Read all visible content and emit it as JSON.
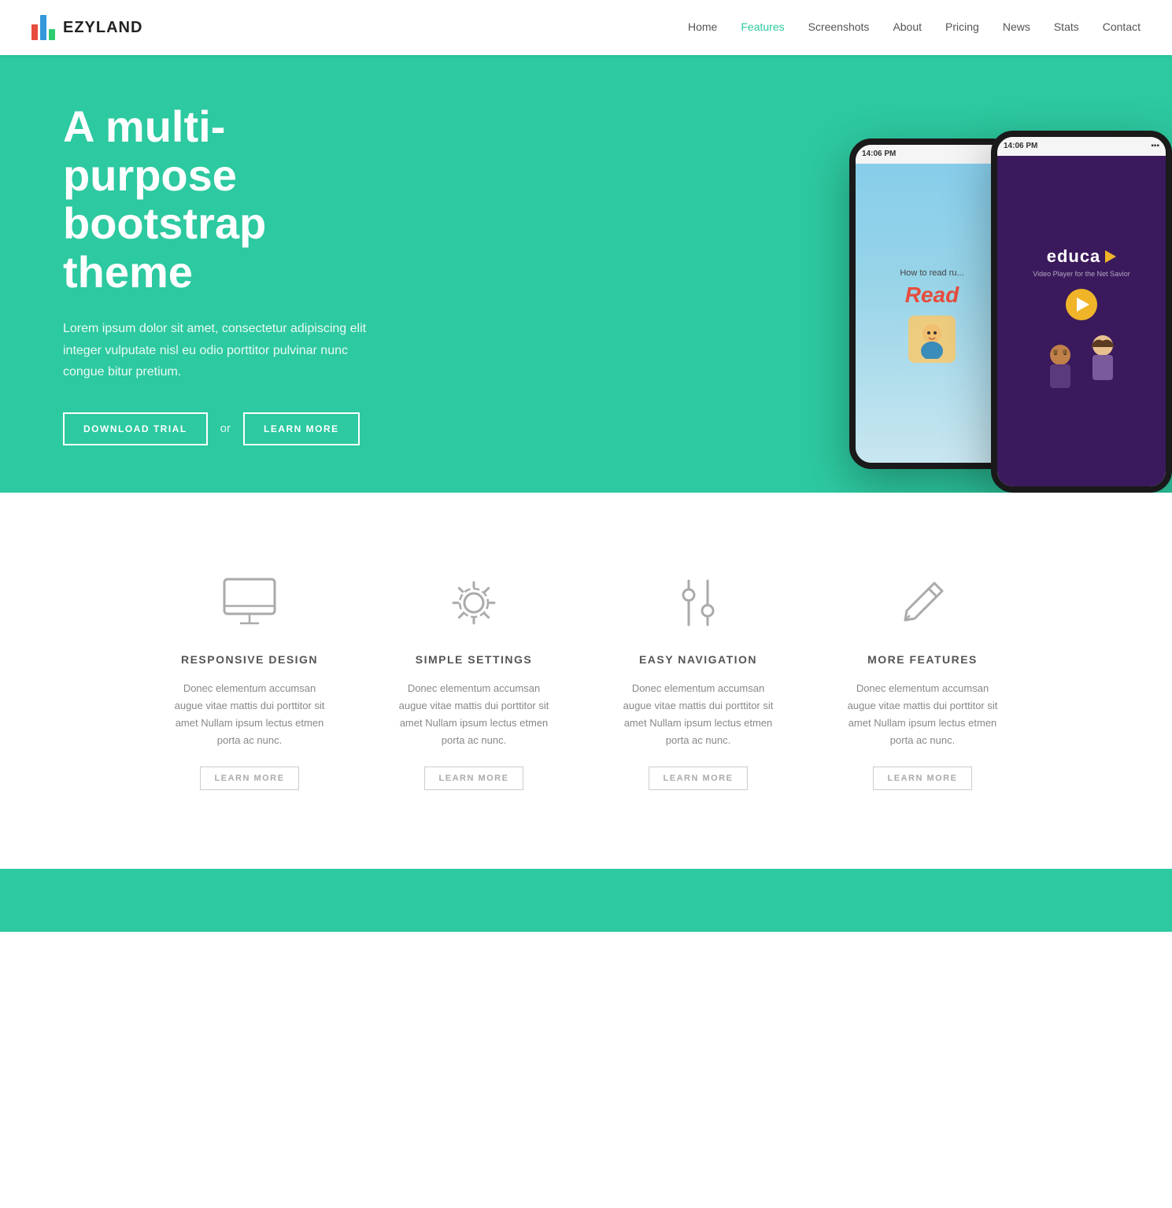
{
  "brand": {
    "name": "EZYLAND"
  },
  "nav": {
    "links": [
      {
        "label": "Home",
        "active": false
      },
      {
        "label": "Features",
        "active": true
      },
      {
        "label": "Screenshots",
        "active": false
      },
      {
        "label": "About",
        "active": false
      },
      {
        "label": "Pricing",
        "active": false
      },
      {
        "label": "News",
        "active": false
      },
      {
        "label": "Stats",
        "active": false
      },
      {
        "label": "Contact",
        "active": false
      }
    ]
  },
  "hero": {
    "title": "A multi-purpose bootstrap theme",
    "description": "Lorem ipsum dolor sit amet, consectetur adipiscing elit integer vulputate nisl eu odio porttitor pulvinar nunc congue bitur pretium.",
    "btn_download": "DOWNLOAD TRIAL",
    "btn_or": "or",
    "btn_learn": "LEARN MORE"
  },
  "phones": {
    "statusbar_time": "14:06 PM",
    "screen1_title": "Read",
    "screen1_subtitle": "How to read ru...",
    "screen2_name": "educa",
    "screen2_tagline": "Video Player for the Net Savior"
  },
  "features": [
    {
      "icon": "monitor",
      "title": "RESPONSIVE DESIGN",
      "description": "Donec elementum accumsan augue vitae mattis dui porttitor sit amet Nullam ipsum lectus etmen porta ac nunc.",
      "btn_label": "LEARN MORE"
    },
    {
      "icon": "settings",
      "title": "SIMPLE SETTINGS",
      "description": "Donec elementum accumsan augue vitae mattis dui porttitor sit amet Nullam ipsum lectus etmen porta ac nunc.",
      "btn_label": "LEARN MORE"
    },
    {
      "icon": "sliders",
      "title": "EASY NAVIGATION",
      "description": "Donec elementum accumsan augue vitae mattis dui porttitor sit amet Nullam ipsum lectus etmen porta ac nunc.",
      "btn_label": "LEARN MORE"
    },
    {
      "icon": "edit",
      "title": "MORE FEATURES",
      "description": "Donec elementum accumsan augue vitae mattis dui porttitor sit amet Nullam ipsum lectus etmen porta ac nunc.",
      "btn_label": "LEARN MORE"
    }
  ]
}
